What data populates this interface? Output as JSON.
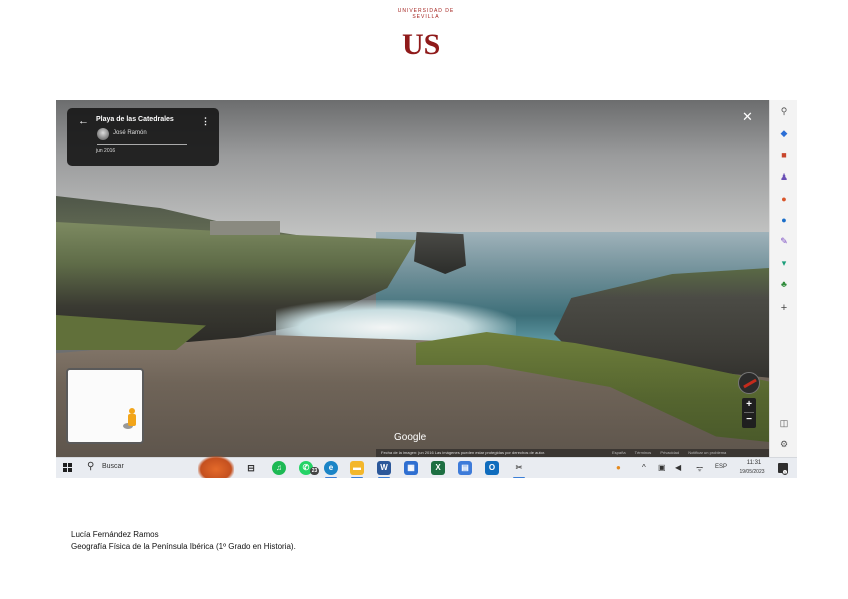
{
  "logo": {
    "arc_text": "UNIVERSIDAD DE SEVILLA",
    "mark": "US"
  },
  "streetview": {
    "place_title": "Playa de las Catedrales",
    "author": "José Ramón",
    "capture_date": "jun 2016",
    "google_label": "Google",
    "footer_text": "Fecha de la imagen: jun 2016    Las imágenes pueden estar protegidas por derechos de autor.",
    "footer_links": [
      "España",
      "Términos",
      "Privacidad",
      "Notificar un problema"
    ],
    "zoom_in": "+",
    "zoom_out": "−"
  },
  "edge_sidebar": {
    "icons": [
      "search-icon",
      "tag-icon",
      "shopping-bag-icon",
      "people-icon",
      "office-icon",
      "outlook-icon",
      "designer-icon",
      "cart-icon",
      "tree-icon",
      "add-icon",
      "split-screen-icon",
      "settings-icon"
    ]
  },
  "taskbar": {
    "search_placeholder": "Buscar",
    "whatsapp_badge": "23",
    "language": "ESP",
    "time": "11:31",
    "date": "19/05/2023",
    "notification_count": "1",
    "colors": {
      "spotify": "#1db954",
      "whatsapp": "#25d366",
      "edge": "#1b84c6",
      "explorer": "#f3b72c",
      "word": "#2b579a",
      "store": "#2f6fd1",
      "excel": "#1d6f42",
      "calendar": "#3d7bd9",
      "outlook": "#0f6cbd",
      "accent": "#3c7fd6"
    }
  },
  "caption": {
    "author": "Lucía Fernández Ramos",
    "course": "Geografía Física de la Península Ibérica (1º Grado en Historia)."
  }
}
